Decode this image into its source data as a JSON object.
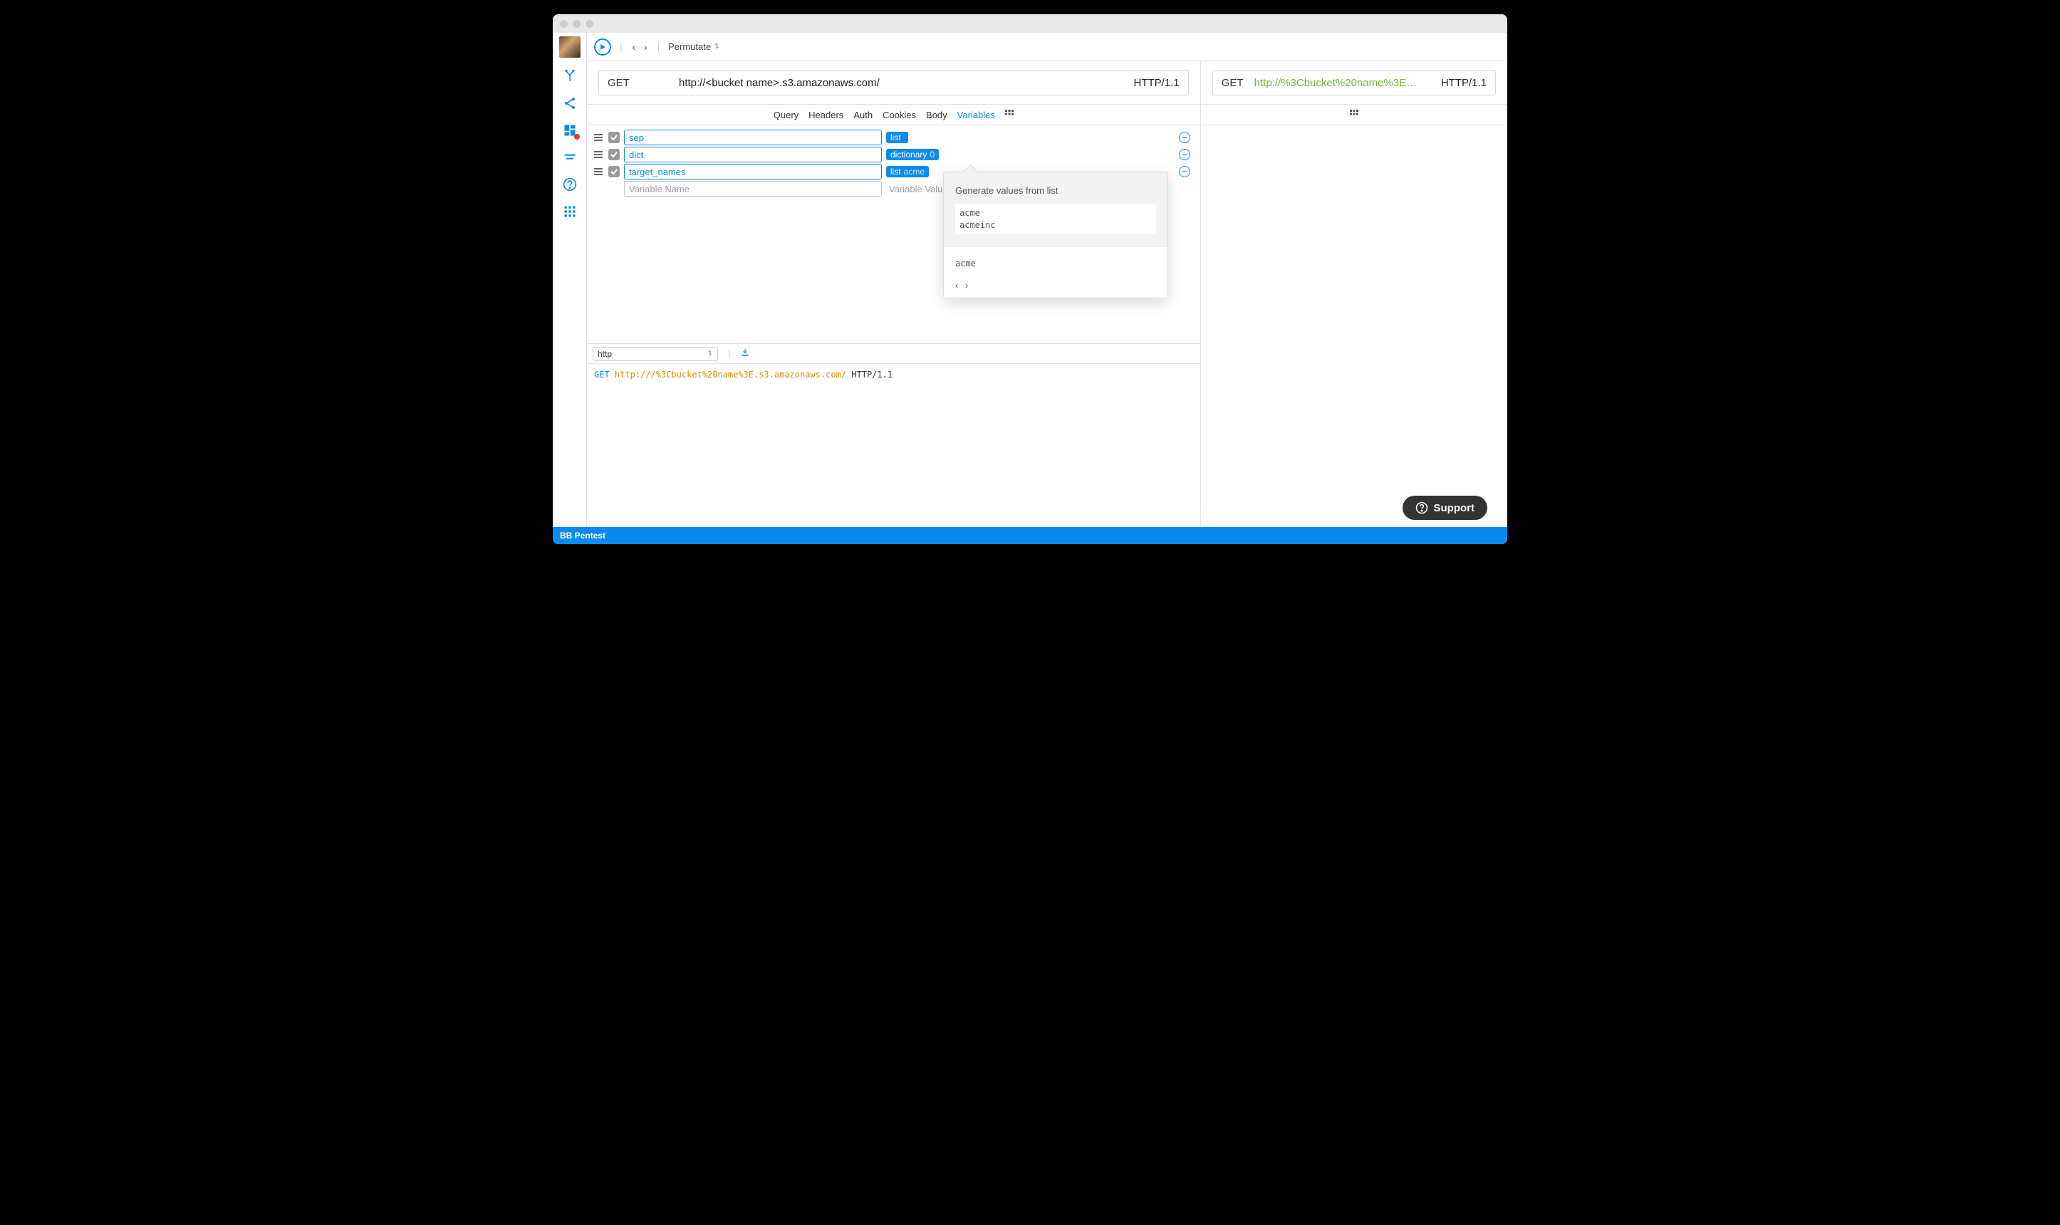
{
  "toolbar": {
    "mode_label": "Permutate"
  },
  "request": {
    "method": "GET",
    "url": "http://<bucket name>.s3.amazonaws.com/",
    "protocol": "HTTP/1.1"
  },
  "response_preview": {
    "method": "GET",
    "url": "http://%3Cbucket%20name%3E…",
    "protocol": "HTTP/1.1"
  },
  "tabs": {
    "query": "Query",
    "headers": "Headers",
    "auth": "Auth",
    "cookies": "Cookies",
    "body": "Body",
    "variables": "Variables"
  },
  "variables": [
    {
      "name": "sep",
      "type": "list",
      "type_suffix": ""
    },
    {
      "name": "dict",
      "type": "dictionary",
      "type_suffix": "0"
    },
    {
      "name": "target_names",
      "type": "list",
      "type_suffix": "acme"
    }
  ],
  "variable_placeholder": "Variable Name",
  "value_placeholder": "Variable Value",
  "popover": {
    "title": "Generate values from list",
    "values_text": "acme\nacmeinc",
    "sample": "acme"
  },
  "raw_toolbar": {
    "format": "http"
  },
  "raw": {
    "method": "GET",
    "url": "http:///%3Cbucket%20name%3E.s3.amazonaws.com/",
    "protocol": "HTTP/1.1"
  },
  "footer": {
    "project": "BB Pentest"
  },
  "support": {
    "label": "Support"
  }
}
